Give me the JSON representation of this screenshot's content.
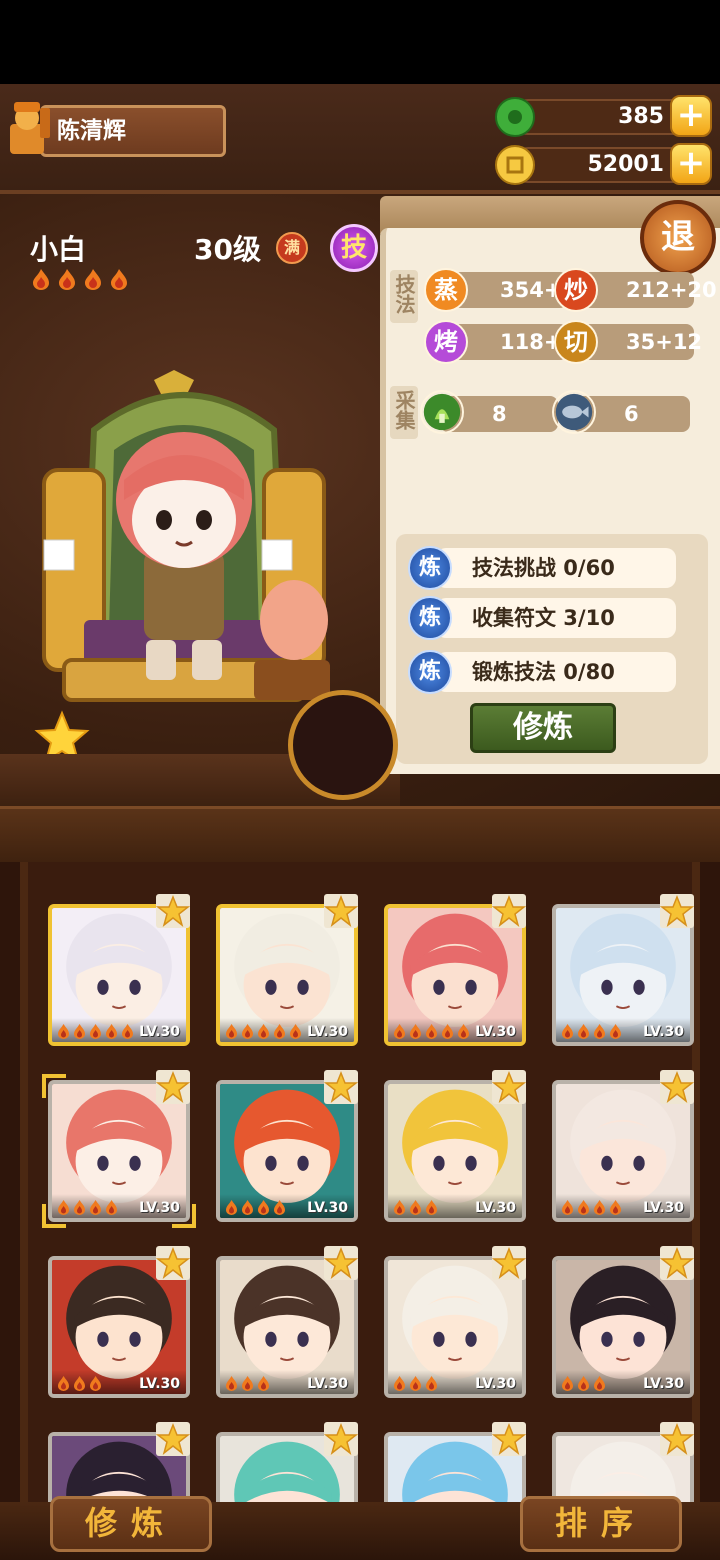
{
  "player": {
    "name": "陈清辉"
  },
  "resources": {
    "jade": "385",
    "coins": "52001"
  },
  "character": {
    "name": "小白",
    "level": "30级",
    "full_badge": "满",
    "skill_badge": "技",
    "flames": 4
  },
  "panel": {
    "back_label": "退",
    "skill_label": "技法",
    "gather_label": "采集",
    "stats": [
      {
        "icon": "蒸",
        "value": "354+16",
        "color": "#f08a22"
      },
      {
        "icon": "炒",
        "value": "212+20",
        "color": "#d9481e"
      },
      {
        "icon": "烤",
        "value": "118+13",
        "color": "#b54bd8"
      },
      {
        "icon": "切",
        "value": "35+12",
        "color": "#c9861c"
      }
    ],
    "gather": [
      {
        "icon_name": "vegetable-icon",
        "value": "8"
      },
      {
        "icon_name": "fish-icon",
        "value": "6"
      }
    ],
    "tasks": [
      {
        "icon": "炼",
        "label": "技法挑战  0/60"
      },
      {
        "icon": "炼",
        "label": "收集符文  3/10"
      },
      {
        "icon": "炼",
        "label": "锻炼技法  0/80"
      }
    ],
    "train_label": "修炼"
  },
  "cards": [
    {
      "level": "LV.30",
      "flames": 5,
      "frame": "gold",
      "hair": "#e9e4ee",
      "skin": "#fbeee4",
      "bg": "#f3eef6"
    },
    {
      "level": "LV.30",
      "flames": 5,
      "frame": "gold",
      "hair": "#f1ede2",
      "skin": "#fbe3d2",
      "bg": "#f5f1e6"
    },
    {
      "level": "LV.30",
      "flames": 5,
      "frame": "gold",
      "hair": "#e76b6b",
      "skin": "#fbe0d0",
      "bg": "#f4c8c0"
    },
    {
      "level": "LV.30",
      "flames": 4,
      "frame": "silver",
      "hair": "#cfe0ef",
      "skin": "#eef2f6",
      "bg": "#dfe9f2"
    },
    {
      "level": "LV.30",
      "flames": 4,
      "frame": "silver",
      "hair": "#e8766a",
      "skin": "#fcefe6",
      "bg": "#f6ddd2",
      "selected": true
    },
    {
      "level": "LV.30",
      "flames": 4,
      "frame": "silver",
      "hair": "#e6582f",
      "skin": "#fde3cf",
      "bg": "#2f8b86"
    },
    {
      "level": "LV.30",
      "flames": 3,
      "frame": "silver",
      "hair": "#f1c43b",
      "skin": "#fde8d6",
      "bg": "#e9dfc5"
    },
    {
      "level": "LV.30",
      "flames": 4,
      "frame": "silver",
      "hair": "#f3e8e1",
      "skin": "#fbe6da",
      "bg": "#efe3db"
    },
    {
      "level": "LV.30",
      "flames": 3,
      "frame": "silver",
      "hair": "#3b2a22",
      "skin": "#fde3cf",
      "bg": "#c43c2a"
    },
    {
      "level": "LV.30",
      "flames": 3,
      "frame": "silver",
      "hair": "#4b3328",
      "skin": "#fde8d8",
      "bg": "#e9dccb"
    },
    {
      "level": "LV.30",
      "flames": 3,
      "frame": "silver",
      "hair": "#f4efe6",
      "skin": "#fde8d6",
      "bg": "#f0e6d8"
    },
    {
      "level": "LV.30",
      "flames": 3,
      "frame": "silver",
      "hair": "#2a1f25",
      "skin": "#fde3d6",
      "bg": "#c9b6a8"
    },
    {
      "level": "",
      "flames": 0,
      "frame": "silver",
      "hair": "#2a2030",
      "skin": "#fde3d6",
      "bg": "#6b4a7a"
    },
    {
      "level": "",
      "flames": 0,
      "frame": "silver",
      "hair": "#5fc7b6",
      "skin": "#fde3d6",
      "bg": "#e8e4dc"
    },
    {
      "level": "",
      "flames": 0,
      "frame": "silver",
      "hair": "#7ac6ea",
      "skin": "#fde3d6",
      "bg": "#dfe9f2"
    },
    {
      "level": "",
      "flames": 0,
      "frame": "silver",
      "hair": "#f4efe9",
      "skin": "#fbeee6",
      "bg": "#efe7e0"
    }
  ],
  "bottom": {
    "train_label": "修炼",
    "sort_label": "排序"
  }
}
